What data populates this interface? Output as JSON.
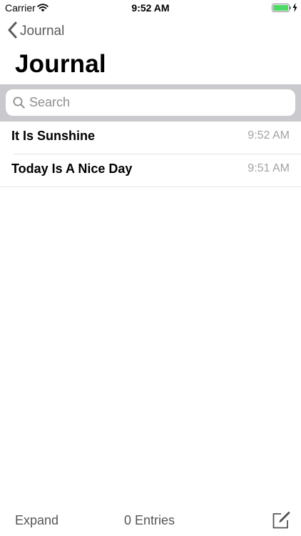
{
  "status_bar": {
    "carrier": "Carrier",
    "time": "9:52 AM",
    "battery_level": 1.0,
    "battery_color": "#4cd964",
    "charging": true,
    "wifi_icon": "wifi-icon",
    "bolt_icon": "charging-bolt-icon"
  },
  "nav": {
    "back_label": "Journal",
    "back_icon": "chevron-left-icon",
    "title": "Journal"
  },
  "search": {
    "placeholder": "Search",
    "value": "",
    "icon": "search-icon"
  },
  "entries": [
    {
      "title": "It Is Sunshine",
      "time": "9:52 AM"
    },
    {
      "title": "Today Is A Nice Day",
      "time": "9:51 AM"
    }
  ],
  "toolbar": {
    "expand_label": "Expand",
    "count_label": "0 Entries",
    "compose_icon": "compose-icon"
  }
}
